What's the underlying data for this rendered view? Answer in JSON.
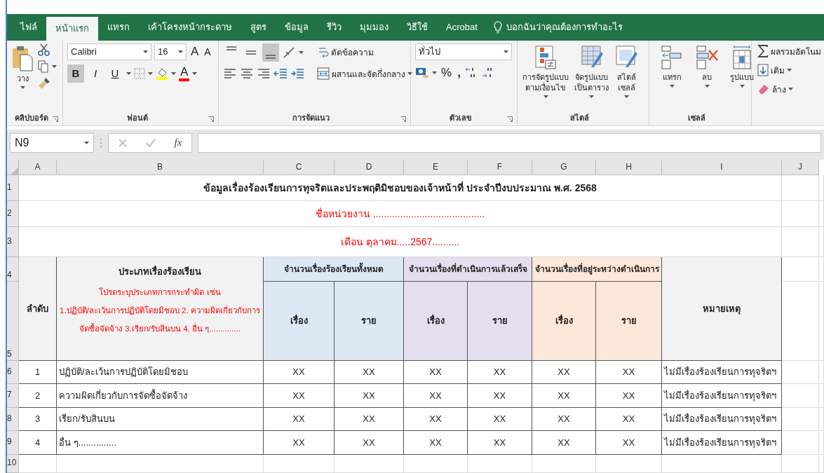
{
  "tabs": [
    {
      "label": "ไฟล์",
      "selected": false
    },
    {
      "label": "หน้าแรก",
      "selected": true
    },
    {
      "label": "แทรก",
      "selected": false
    },
    {
      "label": "เค้าโครงหน้ากระดาษ",
      "selected": false
    },
    {
      "label": "สูตร",
      "selected": false
    },
    {
      "label": "ข้อมูล",
      "selected": false
    },
    {
      "label": "รีวิว",
      "selected": false
    },
    {
      "label": "มุมมอง",
      "selected": false
    },
    {
      "label": "วิธีใช้",
      "selected": false
    },
    {
      "label": "Acrobat",
      "selected": false
    }
  ],
  "tell_me": "บอกฉันว่าคุณต้องการทำอะไร",
  "ribbon": {
    "clipboard": {
      "paste": "วาง",
      "label": "คลิปบอร์ด"
    },
    "font": {
      "name": "Calibri",
      "size": "16",
      "grow": "A",
      "shrink": "A",
      "styles": [
        {
          "glyph": "B",
          "pressed": true
        },
        {
          "glyph": "I",
          "pressed": false
        },
        {
          "glyph": "U",
          "pressed": false
        }
      ],
      "color_glyph": "A",
      "label": "ฟอนต์"
    },
    "alignment": {
      "vertical": [
        {
          "selected": false
        },
        {
          "selected": false
        },
        {
          "selected": true
        }
      ],
      "wrap": "ตัดข้อความ",
      "merge": "ผสานและจัดกึ่งกลาง",
      "label": "การจัดแนว"
    },
    "number": {
      "format": "ทั่วไป",
      "percent": "%",
      "comma": ",",
      "label": "ตัวเลข"
    },
    "styles": {
      "buttons": [
        {
          "lines": [
            "การจัดรูปแบบ",
            "ตามเงื่อนไข"
          ]
        },
        {
          "lines": [
            "จัดรูปแบบ",
            "เป็นตาราง"
          ]
        },
        {
          "lines": [
            "สไตล์",
            "เซลล์"
          ]
        }
      ],
      "label": "สไตล์"
    },
    "cells": {
      "buttons": [
        "แทรก",
        "ลบ",
        "รูปแบบ"
      ],
      "label": "เซลล์"
    },
    "editing": {
      "autosum": "ผลรวมอัตโนม",
      "fill": "เติม",
      "clear": "ล้าง"
    }
  },
  "formula_bar": {
    "name_box": "N9",
    "fx": "fx"
  },
  "sheet": {
    "columns": [
      "A",
      "B",
      "C",
      "D",
      "E",
      "F",
      "G",
      "H",
      "I",
      "J"
    ],
    "row_numbers": [
      "1",
      "2",
      "3",
      "4",
      "5",
      "6",
      "7",
      "8",
      "9",
      "10"
    ],
    "title": "ข้อมูลเรื่องร้องเรียนการทุจริตและประพฤติมิชอบของเจ้าหน้าที่  ประจำปีงบประมาณ พ.ศ. 2568",
    "unit": "ชื่อหน่วยงาน .........................................",
    "month": "เดือน ตุลาคม.....2567..........",
    "header": {
      "no": "ลำดับ",
      "type": "ประเภทเรื่องร้องเรียน",
      "type_note": [
        "โปรดระบุประเภทการกระทำผิด เช่น",
        "1.ปฏิบัติ/ละเว้นการปฏิบัติโดยมิชอบ  2. ความผิดเกี่ยวกับการ",
        "จัดซื้อจัดจ้าง  3.เรียก/รับสินบน  4. อื่น ๆ.............."
      ],
      "groups": [
        {
          "label": "จำนวนเรื่องร้องเรียนทั้งหมด",
          "color": "#dde8f5",
          "sub": [
            "เรื่อง",
            "ราย"
          ]
        },
        {
          "label": "จำนวนเรื่องที่ดำเนินการแล้วเสร็จ",
          "color": "#e4dfee",
          "sub": [
            "เรื่อง",
            "ราย"
          ]
        },
        {
          "label": "จำนวนเรื่องที่อยู่ระหว่างดำเนินการ",
          "color": "#fce8d9",
          "sub": [
            "เรื่อง",
            "ราย"
          ]
        }
      ],
      "remark": "หมายเหตุ"
    },
    "rows": [
      {
        "no": "1",
        "type": "ปฏิบัติ/ละเว้นการปฏิบัติโดยมิชอบ",
        "values": [
          "XX",
          "XX",
          "XX",
          "XX",
          "XX",
          "XX"
        ],
        "remark": "ไม่มีเรื่องร้องเรียนการทุจริตฯ"
      },
      {
        "no": "2",
        "type": "ความผิดเกี่ยวกับการจัดซื้อจัดจ้าง",
        "values": [
          "XX",
          "XX",
          "XX",
          "XX",
          "XX",
          "XX"
        ],
        "remark": "ไม่มีเรื่องร้องเรียนการทุจริตฯ"
      },
      {
        "no": "3",
        "type": "เรียก/รับสินบน",
        "values": [
          "XX",
          "XX",
          "XX",
          "XX",
          "XX",
          "XX"
        ],
        "remark": "ไม่มีเรื่องร้องเรียนการทุจริตฯ"
      },
      {
        "no": "4",
        "type": "อื่น ๆ...............",
        "values": [
          "XX",
          "XX",
          "XX",
          "XX",
          "XX",
          "XX"
        ],
        "remark": "ไม่มีเรื่องร้องเรียนการทุจริตฯ"
      }
    ]
  }
}
